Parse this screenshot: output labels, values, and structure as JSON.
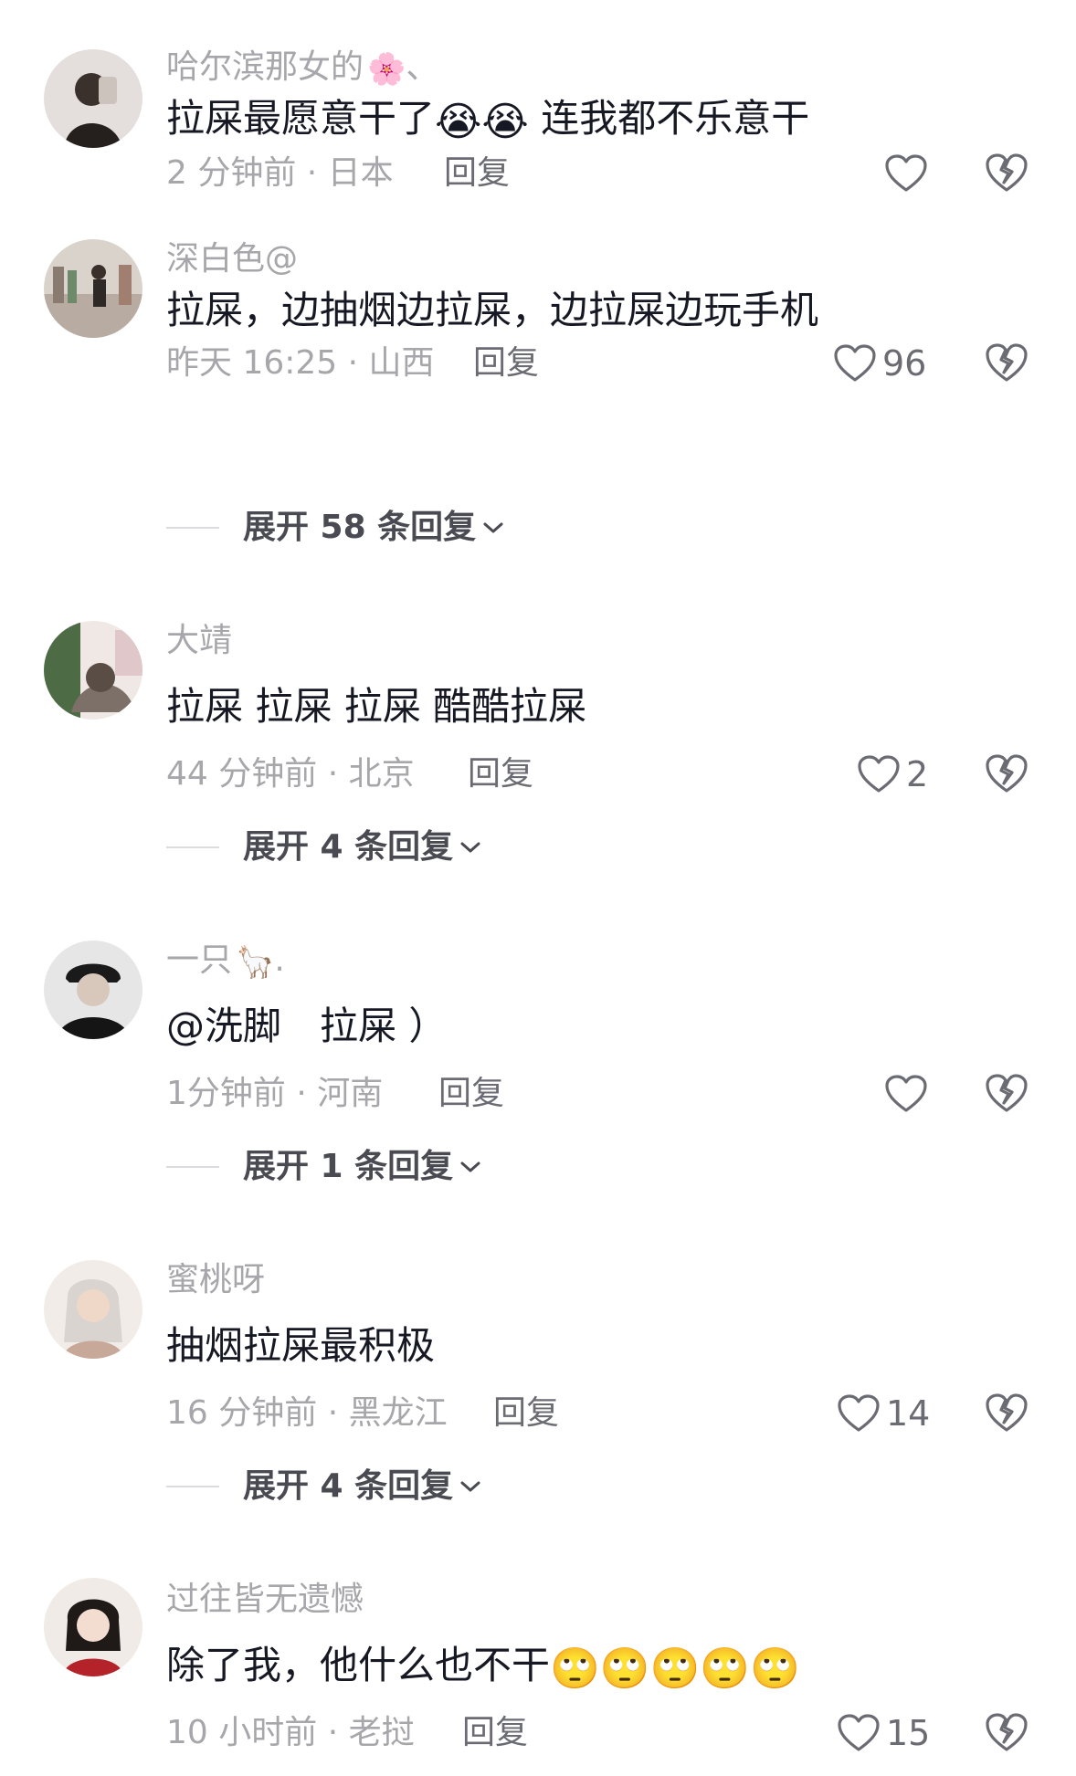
{
  "comments": [
    {
      "username": "哈尔滨那女的",
      "username_suffix_emoji": "🌸",
      "username_tail": "、",
      "text": "拉屎最愿意干了",
      "text_emojis": "😭😭",
      "text_tail": " 连我都不乐意干",
      "meta": "2 分钟前 · 日本",
      "reply": "回复",
      "likes": ""
    },
    {
      "username": "深白色@",
      "text": "拉屎，边抽烟边拉屎，边拉屎边玩手机",
      "meta": "昨天 16:25 · 山西",
      "reply": "回复",
      "likes": "96",
      "expand": "展开 58 条回复"
    },
    {
      "username": "大靖",
      "text": "拉屎 拉屎 拉屎 酷酷拉屎",
      "meta": "44 分钟前 · 北京",
      "reply": "回复",
      "likes": "2",
      "expand": "展开 4 条回复"
    },
    {
      "username": "一只",
      "username_suffix_emoji": "🦙",
      "username_tail": ".",
      "text": "@洗脚　拉屎 ）",
      "meta": "1分钟前 · 河南",
      "reply": "回复",
      "likes": "",
      "expand": "展开 1 条回复"
    },
    {
      "username": "蜜桃呀",
      "text": "抽烟拉屎最积极",
      "meta": "16 分钟前 · 黑龙江",
      "reply": "回复",
      "likes": "14",
      "expand": "展开 4 条回复"
    },
    {
      "username": "过往皆无遗憾",
      "text": "除了我，他什么也不干",
      "text_emojis": "🙄🙄🙄🙄🙄",
      "meta": "10 小时前 · 老挝",
      "reply": "回复",
      "likes": "15"
    }
  ],
  "colors": {
    "secondary_text": "#a6a6ab",
    "primary_text": "#161823",
    "icon_gray": "#6b6b73"
  }
}
